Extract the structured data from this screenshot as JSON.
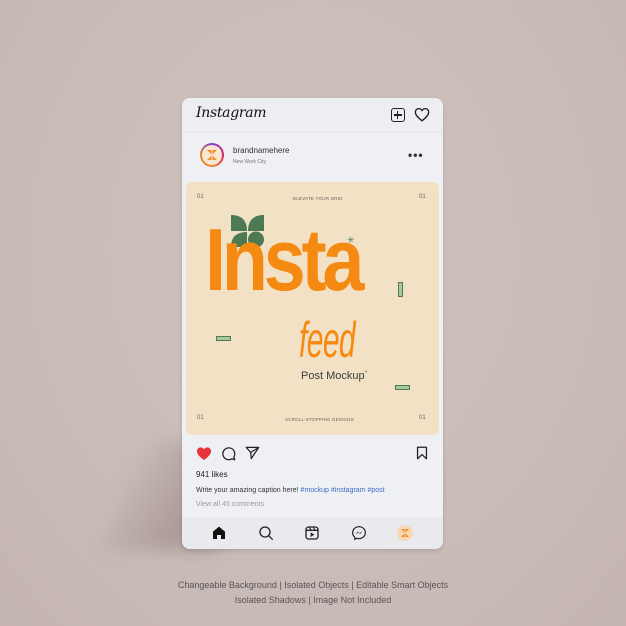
{
  "app": {
    "logo_text": "Instagram",
    "add_icon": "plus-square-icon",
    "notifications_icon": "heart-outline-icon"
  },
  "post_header": {
    "username": "brandnamehere",
    "location": "New Work City",
    "more_label": "•••"
  },
  "post_image": {
    "top_left_num": "01",
    "top_right_num": "01",
    "top_label": "ELEVATE YOUR GRID",
    "headline": "Insta",
    "subhead": "feed",
    "mock_label": "Post Mockup",
    "mock_mark": "´",
    "bottom_left_num": "01",
    "bottom_right_num": "01",
    "bottom_label": "SCROLL-STOPPING DESIGNS",
    "star_glyph": "✳",
    "accent_color": "#f58a12",
    "green_color": "#4d7a52",
    "bg_color": "#f3e1c6"
  },
  "actions": {
    "like_icon": "heart-filled-icon",
    "comment_icon": "comment-icon",
    "share_icon": "send-icon",
    "save_icon": "bookmark-icon",
    "like_color": "#e8323c"
  },
  "likes_text": "941 likes",
  "caption": {
    "text": "Write your amazing caption here! ",
    "tags": "#mockup #instagram #post"
  },
  "comments_text": "View all 45 comments",
  "bottom_nav": [
    {
      "icon": "home-icon"
    },
    {
      "icon": "search-icon"
    },
    {
      "icon": "reels-icon"
    },
    {
      "icon": "messenger-icon"
    },
    {
      "icon": "profile-avatar-icon"
    }
  ],
  "footer": {
    "line1": "Changeable Background | Isolated Objects | Editable Smart Objects",
    "line2": "Isolated Shadows | Image Not Included"
  }
}
